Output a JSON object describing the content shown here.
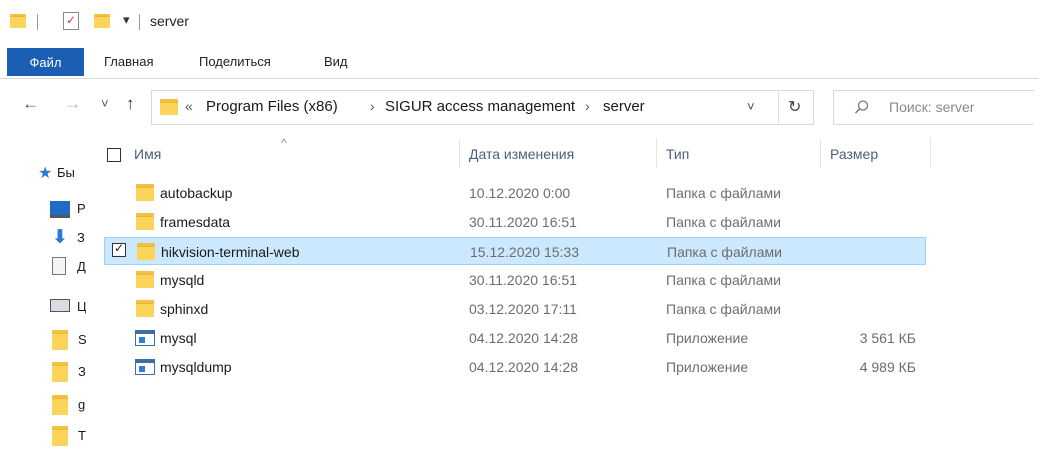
{
  "titlebar": {
    "title": "server",
    "qa_dropdown": "▾"
  },
  "ribbon": {
    "tabs": [
      "Файл",
      "Главная",
      "Поделиться",
      "Вид"
    ]
  },
  "nav": {
    "back": "←",
    "forward": "→",
    "recent": "˅",
    "up": "↑",
    "breadcrumb_prefix": "«",
    "breadcrumb": [
      "Program Files (x86)",
      "SIGUR access management",
      "server"
    ],
    "addr_dropdown": "˅",
    "refresh": "↻",
    "search_placeholder": "Поиск: server"
  },
  "leftpane": {
    "items": [
      {
        "icon": "star-icon",
        "label": "Бы"
      },
      {
        "icon": "desktop-icon",
        "label": "Р"
      },
      {
        "icon": "download-icon",
        "label": "З"
      },
      {
        "icon": "document-icon",
        "label": "Д"
      },
      {
        "icon": "drive-icon",
        "label": "Ц"
      },
      {
        "icon": "folder-icon",
        "label": "S"
      },
      {
        "icon": "folder-icon",
        "label": "З"
      },
      {
        "icon": "folder-icon",
        "label": "g"
      },
      {
        "icon": "folder-icon",
        "label": "Т"
      }
    ]
  },
  "columns": {
    "sort_indicator": "^",
    "name": "Имя",
    "date": "Дата изменения",
    "type": "Тип",
    "size": "Размер"
  },
  "files": [
    {
      "name": "autobackup",
      "date": "10.12.2020 0:00",
      "type": "Папка с файлами",
      "size": "",
      "kind": "folder",
      "selected": false
    },
    {
      "name": "framesdata",
      "date": "30.11.2020 16:51",
      "type": "Папка с файлами",
      "size": "",
      "kind": "folder",
      "selected": false
    },
    {
      "name": "hikvision-terminal-web",
      "date": "15.12.2020 15:33",
      "type": "Папка с файлами",
      "size": "",
      "kind": "folder",
      "selected": true
    },
    {
      "name": "mysqld",
      "date": "30.11.2020 16:51",
      "type": "Папка с файлами",
      "size": "",
      "kind": "folder",
      "selected": false
    },
    {
      "name": "sphinxd",
      "date": "03.12.2020 17:11",
      "type": "Папка с файлами",
      "size": "",
      "kind": "folder",
      "selected": false
    },
    {
      "name": "mysql",
      "date": "04.12.2020 14:28",
      "type": "Приложение",
      "size": "3 561 КБ",
      "kind": "app",
      "selected": false
    },
    {
      "name": "mysqldump",
      "date": "04.12.2020 14:28",
      "type": "Приложение",
      "size": "4 989 КБ",
      "kind": "app",
      "selected": false
    }
  ],
  "colors": {
    "accent": "#1a5fb4",
    "selection": "#cce8ff",
    "folder": "#fbd55a"
  }
}
